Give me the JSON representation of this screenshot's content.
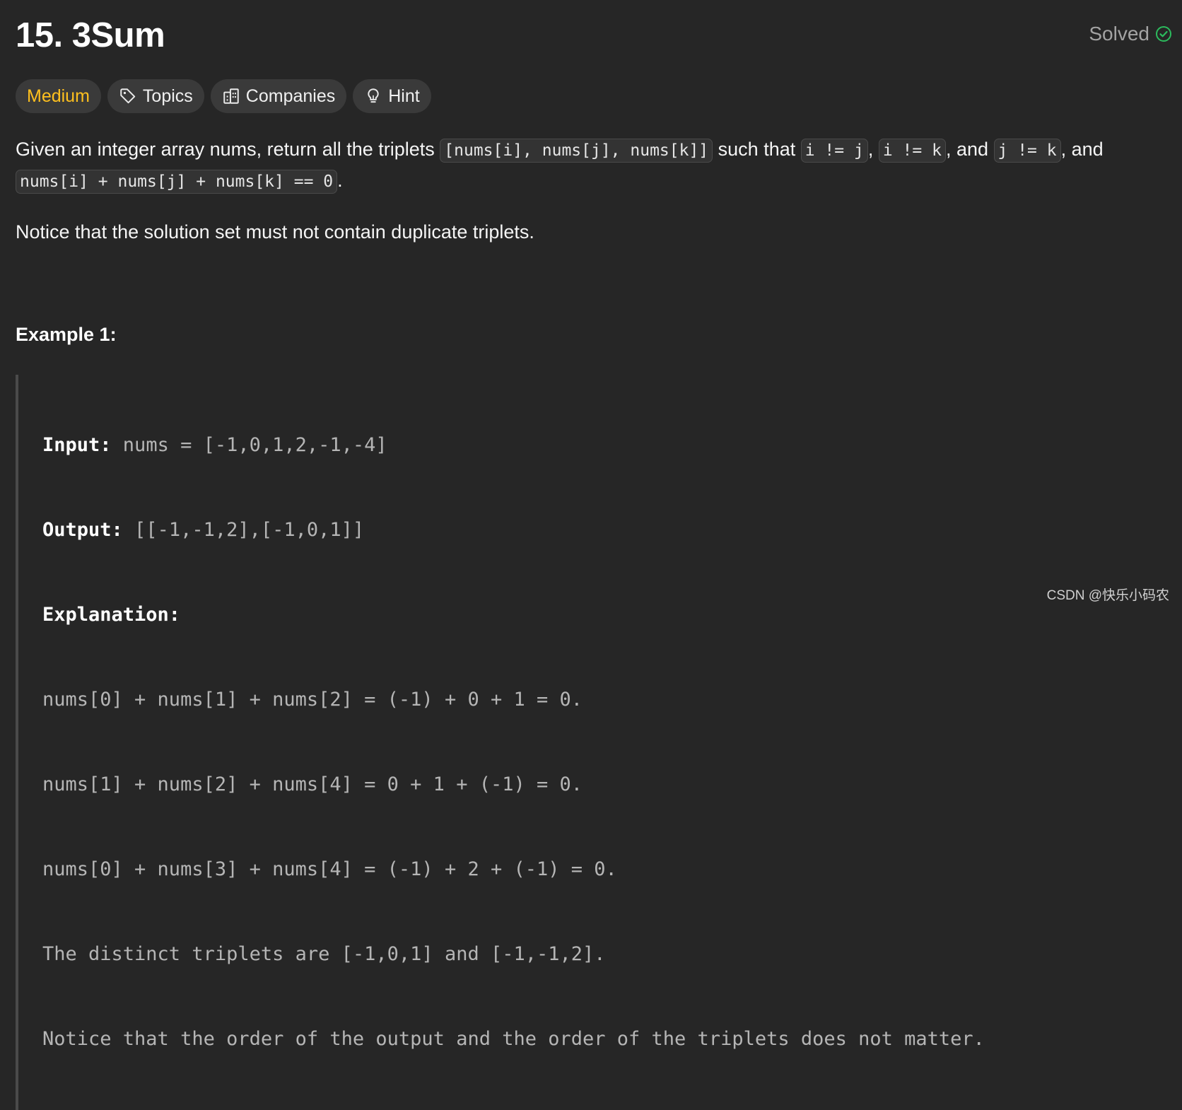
{
  "header": {
    "title": "15. 3Sum",
    "status": "Solved",
    "status_icon": "check-circle-icon",
    "status_color": "#2cbb5d"
  },
  "tags": {
    "difficulty": "Medium",
    "difficulty_color": "#ffc01e",
    "topics": "Topics",
    "companies": "Companies",
    "hint": "Hint"
  },
  "description": {
    "p1_a": "Given an integer array nums, return all the triplets ",
    "code1": "[nums[i], nums[j], nums[k]]",
    "p1_b": " such that ",
    "code2": "i != j",
    "p1_c": ", ",
    "code3": "i != k",
    "p1_d": ", and ",
    "code4": "j != k",
    "p1_e": ", and ",
    "code5": "nums[i] + nums[j] + nums[k] == 0",
    "p1_f": ".",
    "notice": "Notice that the solution set must not contain duplicate triplets."
  },
  "example1": {
    "title": "Example 1:",
    "input_label": "Input:",
    "input_value": " nums = [-1,0,1,2,-1,-4]",
    "output_label": "Output:",
    "output_value": " [[-1,-1,2],[-1,0,1]]",
    "explanation_label": "Explanation:",
    "lines": [
      "nums[0] + nums[1] + nums[2] = (-1) + 0 + 1 = 0.",
      "nums[1] + nums[2] + nums[4] = 0 + 1 + (-1) = 0.",
      "nums[0] + nums[3] + nums[4] = (-1) + 2 + (-1) = 0.",
      "The distinct triplets are [-1,0,1] and [-1,-1,2].",
      "Notice that the order of the output and the order of the triplets does not matter."
    ]
  },
  "watermark": "CSDN @快乐小码农"
}
